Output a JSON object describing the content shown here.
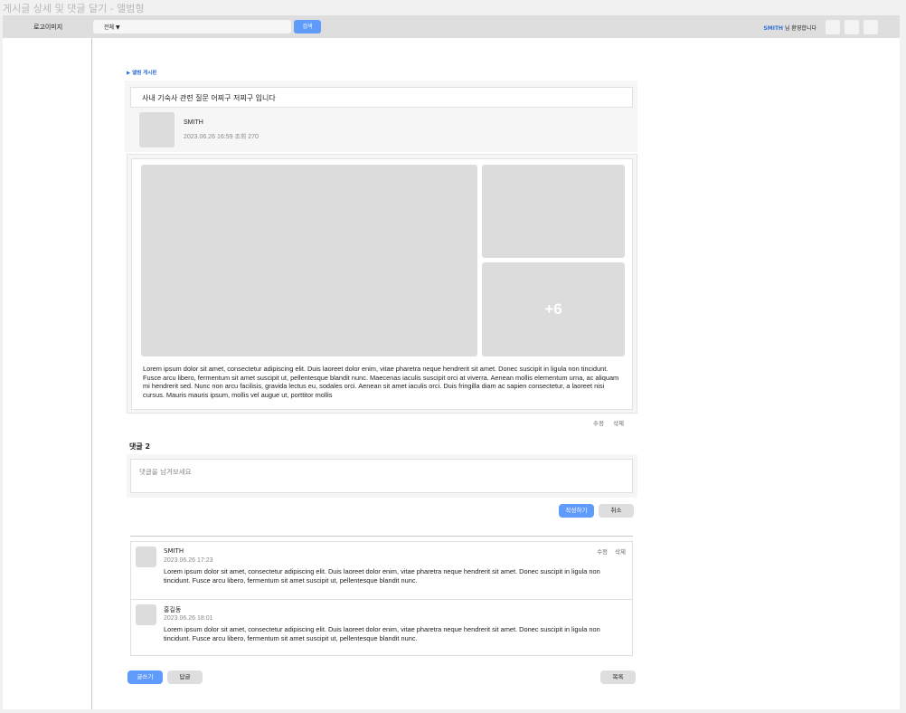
{
  "window_title": "게시글 상세 및 댓글 달기 - 앨범형",
  "header": {
    "logo": "로고이미지",
    "search_select": "전체 ▼",
    "search_button": "검색",
    "user_name": "SMITH",
    "welcome_suffix": " 님  환영합니다"
  },
  "breadcrumb": "▶ 앨범 게시판",
  "post": {
    "title": "사내 기숙사 관련 질문 어찌구 저찌구 입니다",
    "author": "SMITH",
    "meta": "2023.06.26    16:59    조회 270",
    "more_images": "+6",
    "body": "Lorem ipsum dolor sit amet, consectetur adipiscing elit. Duis laoreet dolor enim, vitae pharetra neque hendrerit sit amet. Donec suscipit in ligula non tincidunt. Fusce arcu libero, fermentum sit amet suscipit ut, pellentesque blandit nunc. Maecenas iaculis suscipit orci at viverra. Aenean mollis elementum urna, ac aliquam mi hendrerit sed. Nunc non arcu facilisis, gravida lectus eu, sodales orci. Aenean sit amet iaculis orci. Duis fringilla diam ac sapien consectetur, a laoreet nisi cursus. Mauris mauris ipsum, mollis vel augue ut, porttitor mollis",
    "edit_label": "수정",
    "delete_label": "삭제"
  },
  "comments_section": {
    "heading": "댓글 2",
    "placeholder": "댓글을 남겨보세요",
    "submit_label": "작성하기",
    "cancel_label": "취소"
  },
  "comments": [
    {
      "author": "SMITH",
      "date": "2023.06.26    17:23",
      "text": "Lorem ipsum dolor sit amet, consectetur adipiscing elit. Duis laoreet dolor enim, vitae pharetra neque hendrerit sit amet. Donec suscipit in ligula non tincidunt. Fusce arcu libero, fermentum sit amet suscipit ut, pellentesque blandit nunc.",
      "edit_label": "수정",
      "delete_label": "삭제"
    },
    {
      "author": "홍길동",
      "date": "2023.06.26    18:01",
      "text": "Lorem ipsum dolor sit amet, consectetur adipiscing elit. Duis laoreet dolor enim, vitae pharetra neque hendrerit sit amet. Donec suscipit in ligula non tincidunt. Fusce arcu libero, fermentum sit amet suscipit ut, pellentesque blandit nunc."
    }
  ],
  "footer": {
    "write_label": "글쓰기",
    "reply_label": "답글",
    "list_label": "목록"
  },
  "colors": {
    "accent": "#5e9bfa",
    "placeholder_gray": "#dcdcdc"
  }
}
